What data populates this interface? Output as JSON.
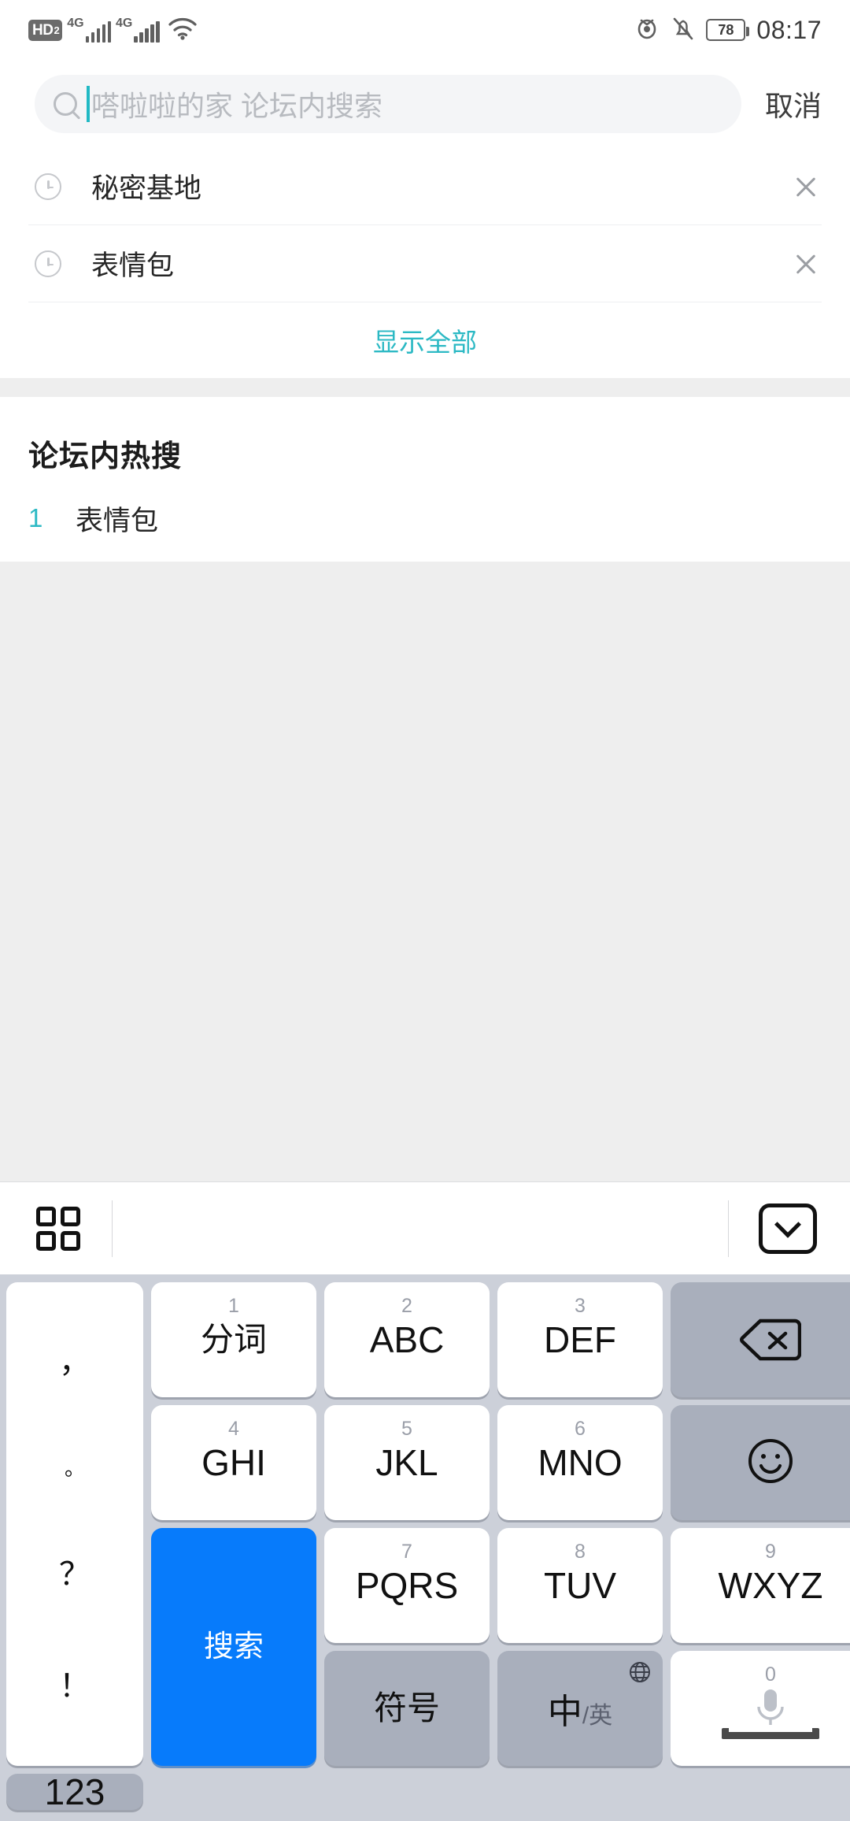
{
  "status_bar": {
    "hd_label": "HD",
    "hd_sub": "2",
    "sim1_net": "4G",
    "sim2_net": "4G",
    "battery_level": "78",
    "time": "08:17",
    "icons": [
      "hd-icon",
      "signal-icon",
      "signal-icon",
      "wifi-icon",
      "eye-protect-icon",
      "mute-bell-icon",
      "battery-icon"
    ]
  },
  "search": {
    "placeholder": "嗒啦啦的家 论坛内搜索",
    "value": "",
    "cancel_label": "取消",
    "accent_color": "#21b9c4"
  },
  "history": {
    "items": [
      {
        "label": "秘密基地"
      },
      {
        "label": "表情包"
      }
    ],
    "show_all_label": "显示全部"
  },
  "hot": {
    "title": "论坛内热搜",
    "items": [
      {
        "rank": "1",
        "label": "表情包"
      }
    ]
  },
  "keyboard_toolbar": {
    "panel_icon": "grid-icon",
    "hide_icon": "hide-keyboard-icon"
  },
  "keyboard": {
    "punctuation": [
      "，",
      "。",
      "？",
      "！"
    ],
    "keys": [
      {
        "num": "1",
        "label": "分词"
      },
      {
        "num": "2",
        "label": "ABC"
      },
      {
        "num": "3",
        "label": "DEF"
      },
      {
        "num": "4",
        "label": "GHI"
      },
      {
        "num": "5",
        "label": "JKL"
      },
      {
        "num": "6",
        "label": "MNO"
      },
      {
        "num": "7",
        "label": "PQRS"
      },
      {
        "num": "8",
        "label": "TUV"
      },
      {
        "num": "9",
        "label": "WXYZ"
      }
    ],
    "backspace": "backspace-icon",
    "emoji": "smiley-icon",
    "enter_label": "搜索",
    "symbol_label": "符号",
    "lang_zh": "中",
    "lang_slash": "/英",
    "space_num": "0",
    "numeric_label": "123",
    "enter_color": "#077bfb"
  }
}
